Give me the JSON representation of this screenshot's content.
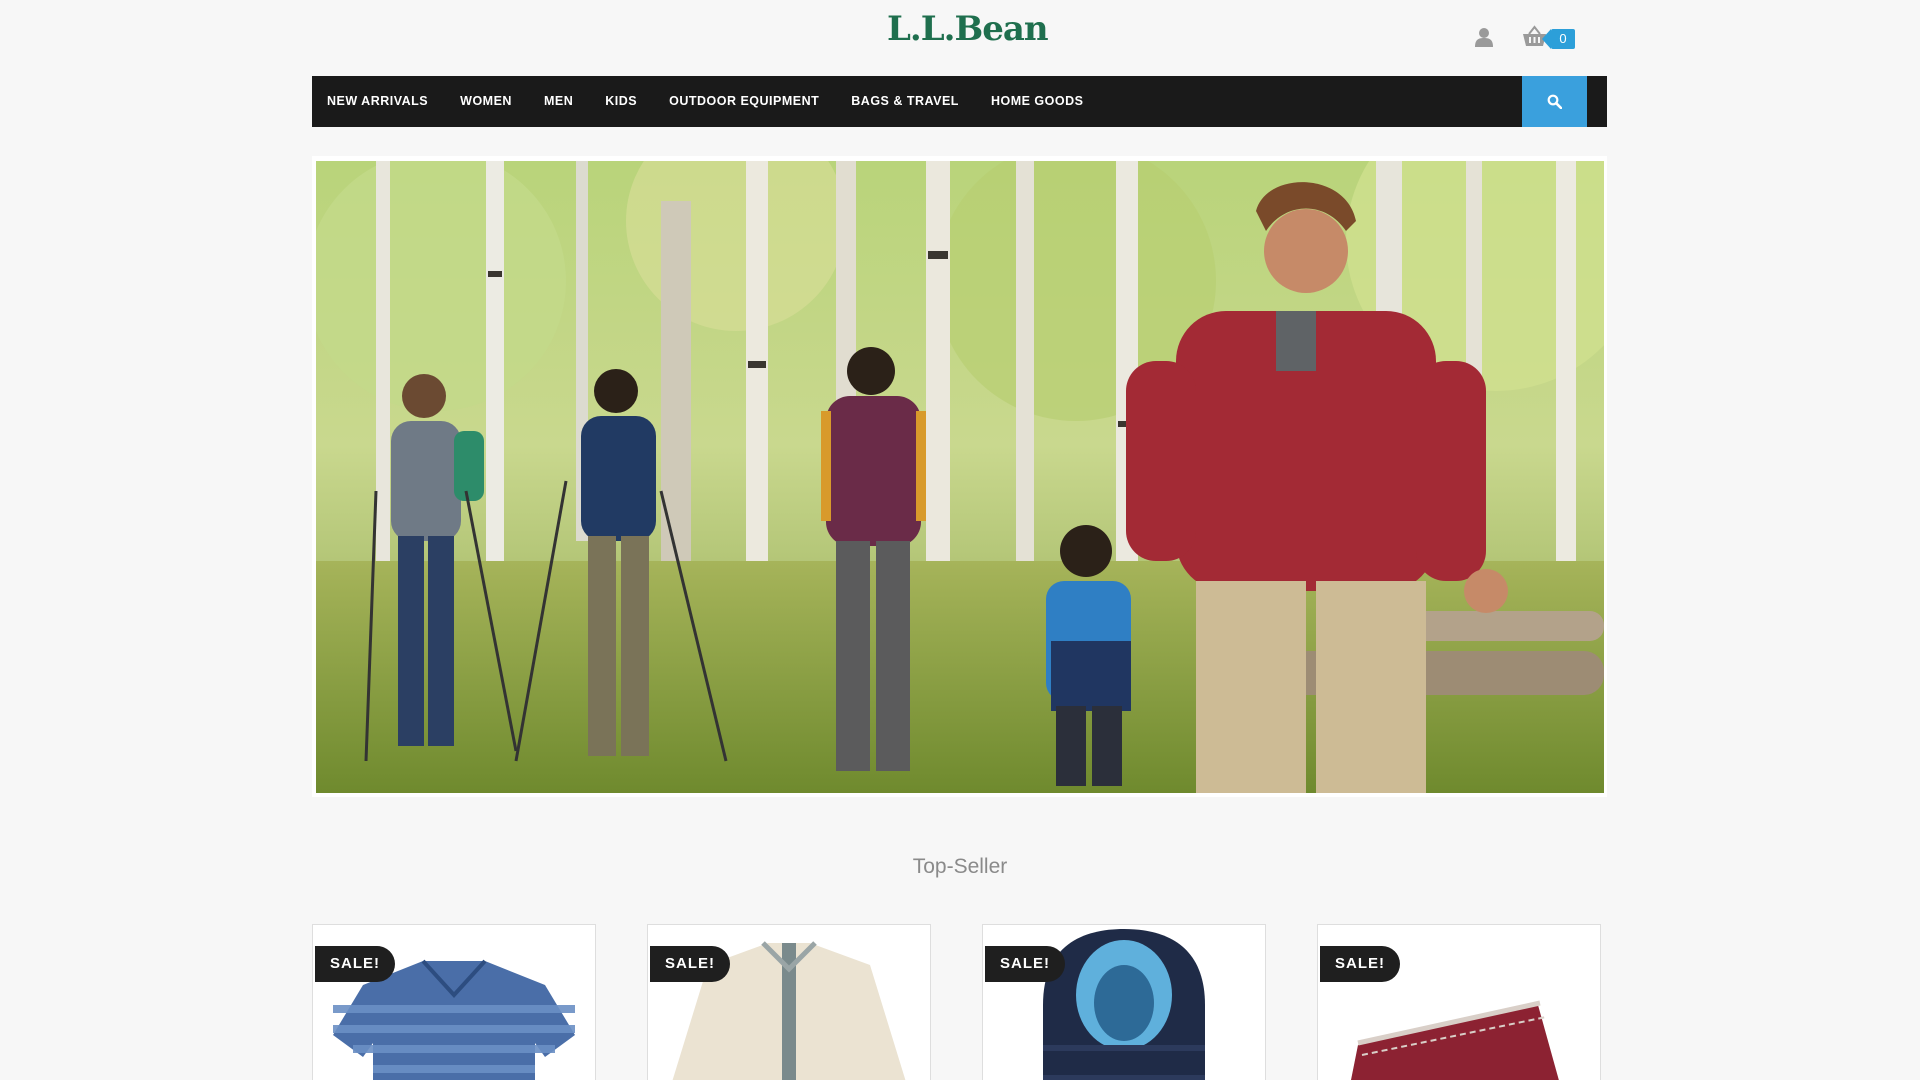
{
  "header": {
    "logo_text": "L.L.Bean",
    "account_icon": "user-icon",
    "cart_icon": "basket-icon",
    "cart_count": "0"
  },
  "nav": {
    "items": [
      {
        "label": "NEW ARRIVALS"
      },
      {
        "label": "WOMEN"
      },
      {
        "label": "MEN"
      },
      {
        "label": "KIDS"
      },
      {
        "label": "OUTDOOR EQUIPMENT"
      },
      {
        "label": "BAGS & TRAVEL"
      },
      {
        "label": "HOME GOODS"
      }
    ],
    "search_icon": "search-icon"
  },
  "hero": {
    "image_description": "photo of a family hiking through an aspen forest"
  },
  "top_seller": {
    "title": "Top-Seller",
    "products": [
      {
        "badge": "SALE!",
        "image": "striped blue polo shirt"
      },
      {
        "badge": "SALE!",
        "image": "cream fleece jacket"
      },
      {
        "badge": "SALE!",
        "image": "navy hooded puffer jacket"
      },
      {
        "badge": "SALE!",
        "image": "red knit garment"
      }
    ]
  },
  "colors": {
    "brand_green": "#1f6f4e",
    "nav_background": "#1a1a1a",
    "accent_blue": "#3aa0dd",
    "badge_background": "#1f1f1f"
  }
}
